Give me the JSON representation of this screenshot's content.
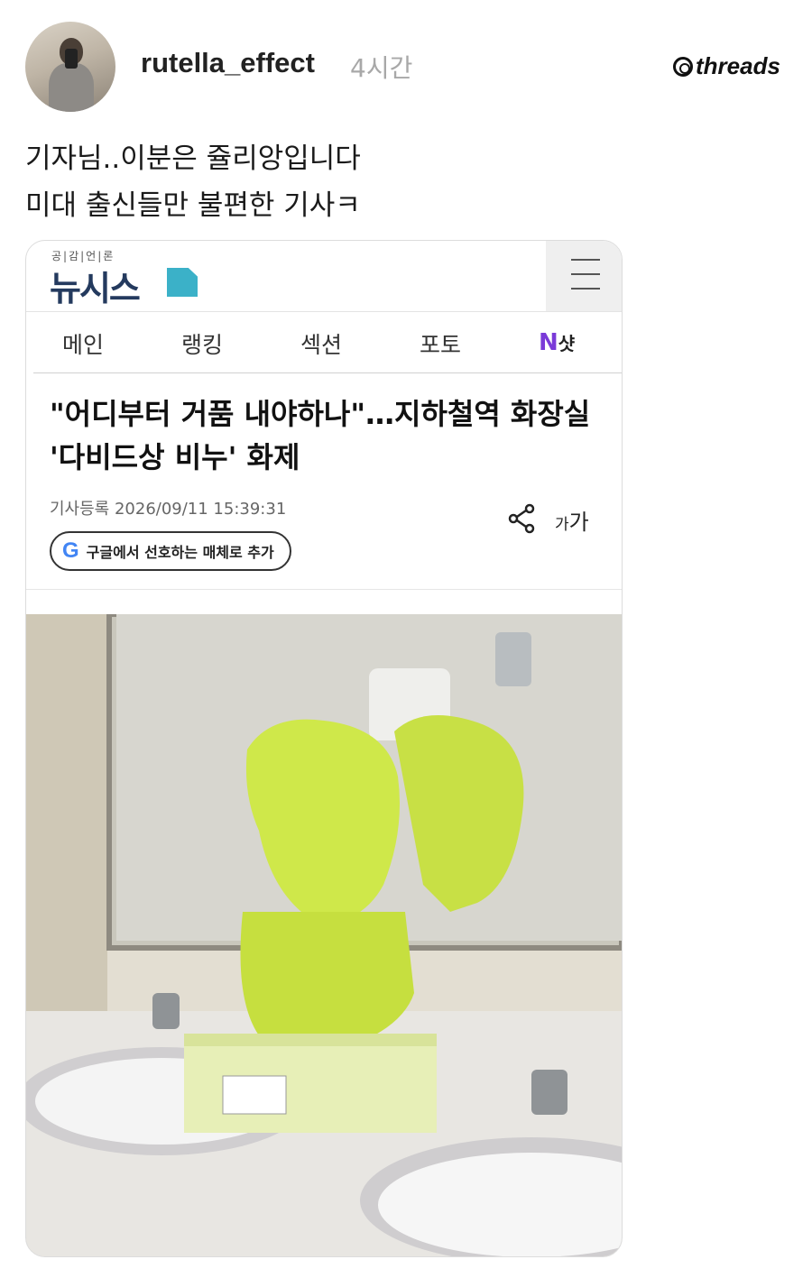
{
  "post": {
    "username": "rutella_effect",
    "time": "4시간",
    "brand": "threads",
    "lines": [
      "기자님..이분은 쥴리앙입니다",
      "미대 출신들만 불편한 기사ㅋ"
    ]
  },
  "news": {
    "tagline": "공|감|언|론",
    "logo": "뉴시스",
    "nav": [
      "메인",
      "랭킹",
      "섹션",
      "포토"
    ],
    "nshot": {
      "n": "N",
      "s": "샷"
    },
    "headline": "\"어디부터 거품 내야하나\"…지하철역 화장실 '다비드상 비누' 화제",
    "meta": "기사등록 2026/09/11 15:39:31",
    "font_small": "가",
    "font_big": "가",
    "google_btn": "구글에서 선호하는 매체로 추가",
    "google_letter": "G"
  },
  "colors": {
    "logo": "#243a5e",
    "accent": "#3bb1c8",
    "soap": "#cfe84a"
  }
}
